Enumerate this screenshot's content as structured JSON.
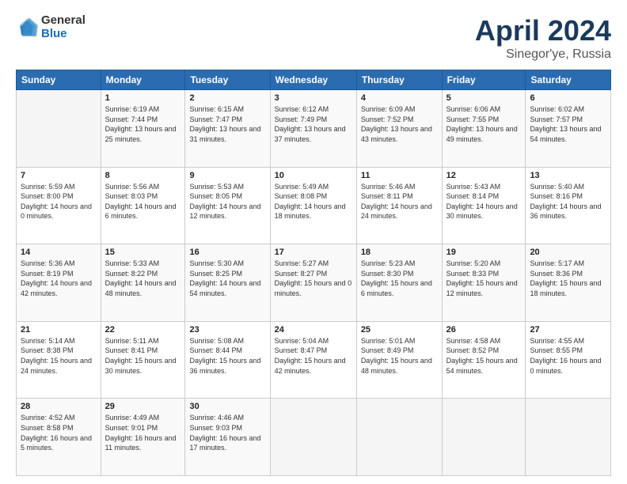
{
  "header": {
    "logo_general": "General",
    "logo_blue": "Blue",
    "title": "April 2024",
    "location": "Sinegor'ye, Russia"
  },
  "weekdays": [
    "Sunday",
    "Monday",
    "Tuesday",
    "Wednesday",
    "Thursday",
    "Friday",
    "Saturday"
  ],
  "weeks": [
    [
      {
        "day": "",
        "sunrise": "",
        "sunset": "",
        "daylight": ""
      },
      {
        "day": "1",
        "sunrise": "Sunrise: 6:19 AM",
        "sunset": "Sunset: 7:44 PM",
        "daylight": "Daylight: 13 hours and 25 minutes."
      },
      {
        "day": "2",
        "sunrise": "Sunrise: 6:15 AM",
        "sunset": "Sunset: 7:47 PM",
        "daylight": "Daylight: 13 hours and 31 minutes."
      },
      {
        "day": "3",
        "sunrise": "Sunrise: 6:12 AM",
        "sunset": "Sunset: 7:49 PM",
        "daylight": "Daylight: 13 hours and 37 minutes."
      },
      {
        "day": "4",
        "sunrise": "Sunrise: 6:09 AM",
        "sunset": "Sunset: 7:52 PM",
        "daylight": "Daylight: 13 hours and 43 minutes."
      },
      {
        "day": "5",
        "sunrise": "Sunrise: 6:06 AM",
        "sunset": "Sunset: 7:55 PM",
        "daylight": "Daylight: 13 hours and 49 minutes."
      },
      {
        "day": "6",
        "sunrise": "Sunrise: 6:02 AM",
        "sunset": "Sunset: 7:57 PM",
        "daylight": "Daylight: 13 hours and 54 minutes."
      }
    ],
    [
      {
        "day": "7",
        "sunrise": "Sunrise: 5:59 AM",
        "sunset": "Sunset: 8:00 PM",
        "daylight": "Daylight: 14 hours and 0 minutes."
      },
      {
        "day": "8",
        "sunrise": "Sunrise: 5:56 AM",
        "sunset": "Sunset: 8:03 PM",
        "daylight": "Daylight: 14 hours and 6 minutes."
      },
      {
        "day": "9",
        "sunrise": "Sunrise: 5:53 AM",
        "sunset": "Sunset: 8:05 PM",
        "daylight": "Daylight: 14 hours and 12 minutes."
      },
      {
        "day": "10",
        "sunrise": "Sunrise: 5:49 AM",
        "sunset": "Sunset: 8:08 PM",
        "daylight": "Daylight: 14 hours and 18 minutes."
      },
      {
        "day": "11",
        "sunrise": "Sunrise: 5:46 AM",
        "sunset": "Sunset: 8:11 PM",
        "daylight": "Daylight: 14 hours and 24 minutes."
      },
      {
        "day": "12",
        "sunrise": "Sunrise: 5:43 AM",
        "sunset": "Sunset: 8:14 PM",
        "daylight": "Daylight: 14 hours and 30 minutes."
      },
      {
        "day": "13",
        "sunrise": "Sunrise: 5:40 AM",
        "sunset": "Sunset: 8:16 PM",
        "daylight": "Daylight: 14 hours and 36 minutes."
      }
    ],
    [
      {
        "day": "14",
        "sunrise": "Sunrise: 5:36 AM",
        "sunset": "Sunset: 8:19 PM",
        "daylight": "Daylight: 14 hours and 42 minutes."
      },
      {
        "day": "15",
        "sunrise": "Sunrise: 5:33 AM",
        "sunset": "Sunset: 8:22 PM",
        "daylight": "Daylight: 14 hours and 48 minutes."
      },
      {
        "day": "16",
        "sunrise": "Sunrise: 5:30 AM",
        "sunset": "Sunset: 8:25 PM",
        "daylight": "Daylight: 14 hours and 54 minutes."
      },
      {
        "day": "17",
        "sunrise": "Sunrise: 5:27 AM",
        "sunset": "Sunset: 8:27 PM",
        "daylight": "Daylight: 15 hours and 0 minutes."
      },
      {
        "day": "18",
        "sunrise": "Sunrise: 5:23 AM",
        "sunset": "Sunset: 8:30 PM",
        "daylight": "Daylight: 15 hours and 6 minutes."
      },
      {
        "day": "19",
        "sunrise": "Sunrise: 5:20 AM",
        "sunset": "Sunset: 8:33 PM",
        "daylight": "Daylight: 15 hours and 12 minutes."
      },
      {
        "day": "20",
        "sunrise": "Sunrise: 5:17 AM",
        "sunset": "Sunset: 8:36 PM",
        "daylight": "Daylight: 15 hours and 18 minutes."
      }
    ],
    [
      {
        "day": "21",
        "sunrise": "Sunrise: 5:14 AM",
        "sunset": "Sunset: 8:38 PM",
        "daylight": "Daylight: 15 hours and 24 minutes."
      },
      {
        "day": "22",
        "sunrise": "Sunrise: 5:11 AM",
        "sunset": "Sunset: 8:41 PM",
        "daylight": "Daylight: 15 hours and 30 minutes."
      },
      {
        "day": "23",
        "sunrise": "Sunrise: 5:08 AM",
        "sunset": "Sunset: 8:44 PM",
        "daylight": "Daylight: 15 hours and 36 minutes."
      },
      {
        "day": "24",
        "sunrise": "Sunrise: 5:04 AM",
        "sunset": "Sunset: 8:47 PM",
        "daylight": "Daylight: 15 hours and 42 minutes."
      },
      {
        "day": "25",
        "sunrise": "Sunrise: 5:01 AM",
        "sunset": "Sunset: 8:49 PM",
        "daylight": "Daylight: 15 hours and 48 minutes."
      },
      {
        "day": "26",
        "sunrise": "Sunrise: 4:58 AM",
        "sunset": "Sunset: 8:52 PM",
        "daylight": "Daylight: 15 hours and 54 minutes."
      },
      {
        "day": "27",
        "sunrise": "Sunrise: 4:55 AM",
        "sunset": "Sunset: 8:55 PM",
        "daylight": "Daylight: 16 hours and 0 minutes."
      }
    ],
    [
      {
        "day": "28",
        "sunrise": "Sunrise: 4:52 AM",
        "sunset": "Sunset: 8:58 PM",
        "daylight": "Daylight: 16 hours and 5 minutes."
      },
      {
        "day": "29",
        "sunrise": "Sunrise: 4:49 AM",
        "sunset": "Sunset: 9:01 PM",
        "daylight": "Daylight: 16 hours and 11 minutes."
      },
      {
        "day": "30",
        "sunrise": "Sunrise: 4:46 AM",
        "sunset": "Sunset: 9:03 PM",
        "daylight": "Daylight: 16 hours and 17 minutes."
      },
      {
        "day": "",
        "sunrise": "",
        "sunset": "",
        "daylight": ""
      },
      {
        "day": "",
        "sunrise": "",
        "sunset": "",
        "daylight": ""
      },
      {
        "day": "",
        "sunrise": "",
        "sunset": "",
        "daylight": ""
      },
      {
        "day": "",
        "sunrise": "",
        "sunset": "",
        "daylight": ""
      }
    ]
  ]
}
